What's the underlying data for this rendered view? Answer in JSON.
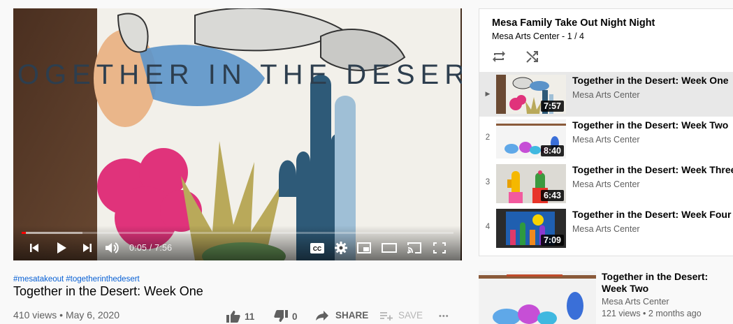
{
  "player": {
    "overlay_text": "TOGETHER IN THE DESERT",
    "current_time": "0:05",
    "time_separator": " / ",
    "duration": "7:56",
    "progress_fraction": 0.0105,
    "buffered_fraction": 0.14,
    "cc_label": "CC",
    "colors": {
      "progress": "#ff0000"
    }
  },
  "video": {
    "hashtags": [
      "#mesatakeout",
      "#togetherinthedesert"
    ],
    "title": "Together in the Desert: Week One",
    "views": "410 views",
    "meta_separator": " • ",
    "date": "May 6, 2020",
    "actions": {
      "like_count": "11",
      "dislike_count": "0",
      "share_label": "SHARE",
      "save_label": "SAVE",
      "more_label": "•••"
    }
  },
  "playlist": {
    "title": "Mesa Family Take Out Night Night",
    "channel": "Mesa Arts Center",
    "sub_separator": " - ",
    "position": "1 / 4",
    "now_playing_marker": "▶",
    "items": [
      {
        "index": "1",
        "title": "Together in the Desert: Week One",
        "channel": "Mesa Arts Center",
        "duration": "7:57"
      },
      {
        "index": "2",
        "title": "Together in the Desert: Week Two",
        "channel": "Mesa Arts Center",
        "duration": "8:40"
      },
      {
        "index": "3",
        "title": "Together in the Desert: Week Three",
        "channel": "Mesa Arts Center",
        "duration": "6:43"
      },
      {
        "index": "4",
        "title": "Together in the Desert: Week Four",
        "channel": "Mesa Arts Center",
        "duration": "7:09"
      }
    ]
  },
  "up_next": {
    "title": "Together in the Desert: Week Two",
    "channel": "Mesa Arts Center",
    "stats": "121 views • 2 months ago"
  }
}
